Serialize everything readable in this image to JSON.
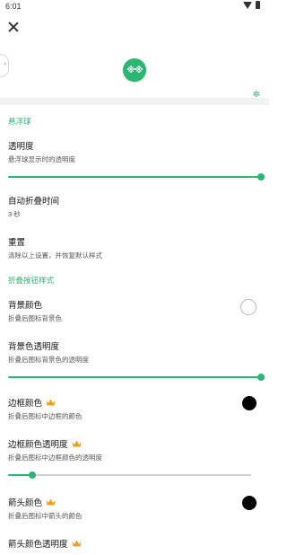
{
  "status": {
    "time": "6:01"
  },
  "colors": {
    "accent": "#2bb673",
    "swatch_white": "#ffffff",
    "swatch_black": "#000000",
    "crown": "#f0a020"
  },
  "floating_ball": {
    "label": "※※"
  },
  "sections": [
    {
      "header": "悬浮球"
    },
    {
      "header": "折叠按钮样式"
    }
  ],
  "items": {
    "opacity": {
      "title": "透明度",
      "subtitle": "悬浮球显示时的透明度",
      "value": 1.0
    },
    "auto_fold": {
      "title": "自动折叠时间",
      "subtitle": "3 秒"
    },
    "reset": {
      "title": "重置",
      "subtitle": "清除以上设置，并恢复默认样式"
    },
    "bg_color": {
      "title": "背景颜色",
      "subtitle": "折叠后图标背景色"
    },
    "bg_opacity": {
      "title": "背景色透明度",
      "subtitle": "折叠后图标背景色的透明度",
      "value": 1.0
    },
    "border_color": {
      "title": "边框颜色",
      "subtitle": "折叠后图标中边框的颜色",
      "premium": true
    },
    "border_opacity": {
      "title": "边框颜色透明度",
      "subtitle": "折叠后图标中边框颜色的透明度",
      "premium": true,
      "value": 0.1
    },
    "arrow_color": {
      "title": "箭头颜色",
      "subtitle": "折叠后图标中箭头的颜色",
      "premium": true
    },
    "arrow_opacity": {
      "title": "箭头颜色透明度",
      "premium": true
    }
  },
  "icons": {
    "close": "close-icon",
    "sparkle": "sparkle-icon",
    "crown": "crown-icon",
    "wifi": "wifi-icon",
    "battery": "battery-icon"
  }
}
